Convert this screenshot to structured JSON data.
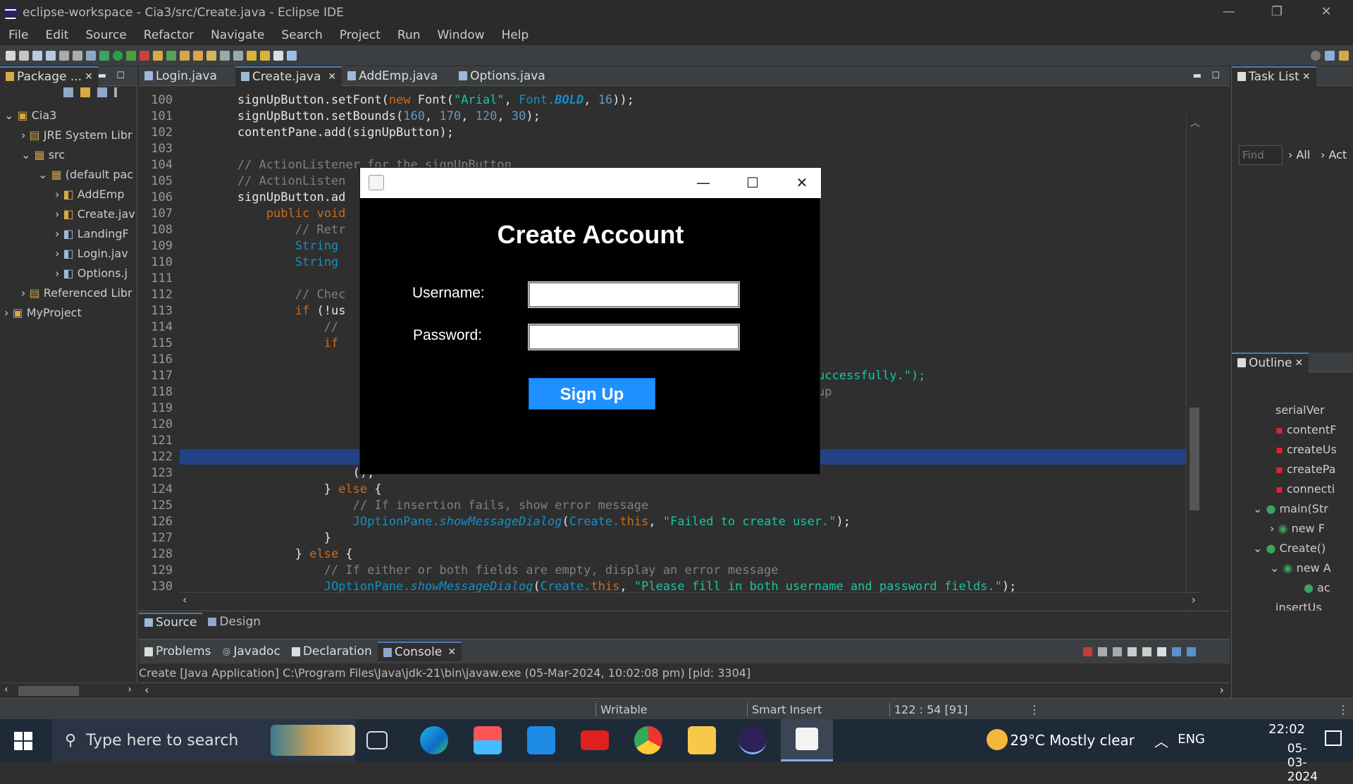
{
  "window": {
    "title": "eclipse-workspace - Cia3/src/Create.java - Eclipse IDE",
    "min": "—",
    "max": "❐",
    "close": "✕"
  },
  "menu": [
    "File",
    "Edit",
    "Source",
    "Refactor",
    "Navigate",
    "Search",
    "Project",
    "Run",
    "Window",
    "Help"
  ],
  "package_explorer": {
    "tab": "Package ...",
    "tree": [
      {
        "arrow": "⌄",
        "label": "Cia3"
      },
      {
        "arrow": "›",
        "label": "JRE System Libr"
      },
      {
        "arrow": "⌄",
        "label": "src"
      },
      {
        "arrow": "⌄",
        "label": "(default pac"
      },
      {
        "arrow": "›",
        "label": "AddEmp"
      },
      {
        "arrow": "›",
        "label": "Create.jav"
      },
      {
        "arrow": "›",
        "label": "LandingF"
      },
      {
        "arrow": "›",
        "label": "Login.jav"
      },
      {
        "arrow": "›",
        "label": "Options.j"
      },
      {
        "arrow": "›",
        "label": "Referenced Libr"
      },
      {
        "arrow": "›",
        "label": "MyProject"
      }
    ]
  },
  "editor": {
    "tabs": [
      {
        "label": "Login.java"
      },
      {
        "label": "Create.java",
        "close": "✕"
      },
      {
        "label": "AddEmp.java"
      },
      {
        "label": "Options.java"
      }
    ],
    "line_numbers": [
      "100",
      "101",
      "102",
      "103",
      "104",
      "105",
      "106",
      "107",
      "108",
      "109",
      "110",
      "111",
      "112",
      "113",
      "114",
      "115",
      "116",
      "117",
      "118",
      "119",
      "120",
      "121",
      "122",
      "123",
      "124",
      "125",
      "126",
      "127",
      "128",
      "129",
      "130"
    ],
    "code": {
      "l100a": "        signUpButton.setFont(",
      "l100kw": "new",
      "l100b": " Font(",
      "l100st": "\"Arial\"",
      "l100c": ", ",
      "l100cl": "Font.",
      "l100it": "BOLD",
      "l100d": ", ",
      "l100nm": "16",
      "l100e": "));",
      "l101a": "        signUpButton.setBounds(",
      "l101n1": "160",
      "l101b": ", ",
      "l101n2": "170",
      "l101c": ", ",
      "l101n3": "120",
      "l101d": ", ",
      "l101n4": "30",
      "l101e": ");",
      "l102": "        contentPane.add(signUpButton);",
      "l104": "        // ActionListener for the signUpButton",
      "l105": "        // ActionListen",
      "l106": "        signUpButton.ad",
      "l107kw": "            public void",
      "l108": "                // Retr",
      "l109": "                String",
      "l110": "                String",
      "l112": "                // Chec",
      "l113a": "                ",
      "l113kw": "if",
      "l113b": " (!us",
      "l114": "                    //",
      "l115kw": "                    if",
      "l117": "uccessfully.\");",
      "l118": "up",
      "l123": "                        ();",
      "l124a": "                    } ",
      "l124kw": "else",
      "l124b": " {",
      "l125": "                        // If insertion fails, show error message",
      "l126a": "                        ",
      "l126cl": "JOptionPane.",
      "l126it": "showMessageDialog",
      "l126b": "(",
      "l126cl2": "Create.",
      "l126kw": "this",
      "l126c": ", ",
      "l126st": "\"Failed to create user.\"",
      "l126d": ");",
      "l127": "                    }",
      "l128a": "                } ",
      "l128kw": "else",
      "l128b": " {",
      "l129": "                    // If either or both fields are empty, display an error message",
      "l130a": "                    ",
      "l130cl": "JOptionPane.",
      "l130it": "showMessageDialog",
      "l130b": "(",
      "l130cl2": "Create.",
      "l130kw": "this",
      "l130c": ", ",
      "l130st": "\"Please fill in both username and password fields.\"",
      "l130d": ");"
    },
    "bottom_tabs": [
      "Source",
      "Design"
    ]
  },
  "console": {
    "tabs": [
      "Problems",
      "Javadoc",
      "Declaration",
      "Console"
    ],
    "console_close": "✕",
    "line": "Create [Java Application] C:\\Program Files\\Java\\jdk-21\\bin\\javaw.exe  (05-Mar-2024, 10:02:08 pm) [pid: 3304]"
  },
  "right": {
    "tasklist_tab": "Task List",
    "find_placeholder": "Find",
    "all": "All",
    "act": "Act",
    "outline_tab": "Outline",
    "outline": [
      {
        "label": "serialVer"
      },
      {
        "label": "contentF"
      },
      {
        "label": "createUs"
      },
      {
        "label": "createPa"
      },
      {
        "label": "connecti"
      },
      {
        "label": "main(Str"
      },
      {
        "label": "new F"
      },
      {
        "label": "Create()"
      },
      {
        "label": "new A"
      },
      {
        "label": "ac"
      },
      {
        "label": "insertUs"
      }
    ]
  },
  "status": {
    "writable": "Writable",
    "insert": "Smart Insert",
    "position": "122 : 54 [91]"
  },
  "dialog": {
    "heading": "Create Account",
    "username_label": "Username:",
    "password_label": "Password:",
    "username_value": "",
    "password_value": "",
    "button": "Sign Up",
    "min": "—",
    "max": "☐",
    "close": "✕"
  },
  "taskbar": {
    "search_placeholder": "Type here to search",
    "weather": "29°C  Mostly clear",
    "lang": "ENG",
    "time": "22:02",
    "date": "05-03-2024"
  }
}
